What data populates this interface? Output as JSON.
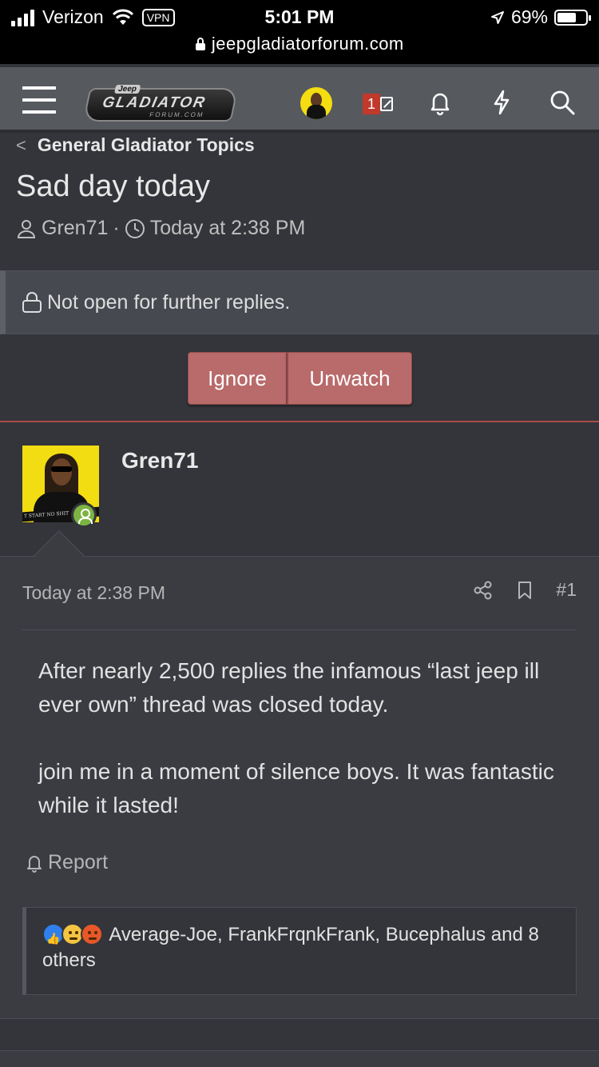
{
  "status_bar": {
    "carrier": "Verizon",
    "vpn": "VPN",
    "time": "5:01 PM",
    "battery": "69%",
    "battery_level": 0.69,
    "url": "jeepgladiatorforum.com"
  },
  "header": {
    "logo_top": "Jeep",
    "logo_main": "GLADIATOR",
    "logo_sub": "FORUM.COM",
    "inbox_count": "1"
  },
  "thread": {
    "breadcrumb": "General Gladiator Topics",
    "title": "Sad day today",
    "author": "Gren71",
    "separator": "·",
    "date": "Today at 2:38 PM"
  },
  "notice": {
    "text": "Not open for further replies."
  },
  "buttons": {
    "ignore": "Ignore",
    "unwatch": "Unwatch"
  },
  "post": {
    "username": "Gren71",
    "avatar_banner": "T START NO SHIT",
    "date": "Today at 2:38 PM",
    "number": "#1",
    "paragraphs": [
      "After nearly 2,500 replies the infamous “last jeep ill ever own” thread was closed today.",
      "join me in a moment of silence boys. It was fantastic while it lasted!"
    ],
    "report": "Report",
    "reactions_text": "Average-Joe, FrankFrqnkFrank, Bucephalus and 8 others"
  },
  "colors": {
    "background": "#33353a",
    "header": "#56595e",
    "button": "#b96a6a",
    "accent_line": "#a94b4b",
    "online": "#7cb342"
  },
  "icons": [
    "wifi-icon",
    "location-arrow-icon",
    "lock-icon",
    "hamburger-icon",
    "envelope-icon",
    "bell-icon",
    "bolt-icon",
    "search-icon",
    "user-icon",
    "clock-icon",
    "share-icon",
    "bookmark-icon",
    "report-bell-icon",
    "like-reaction-icon",
    "confused-reaction-icon",
    "angry-reaction-icon"
  ]
}
